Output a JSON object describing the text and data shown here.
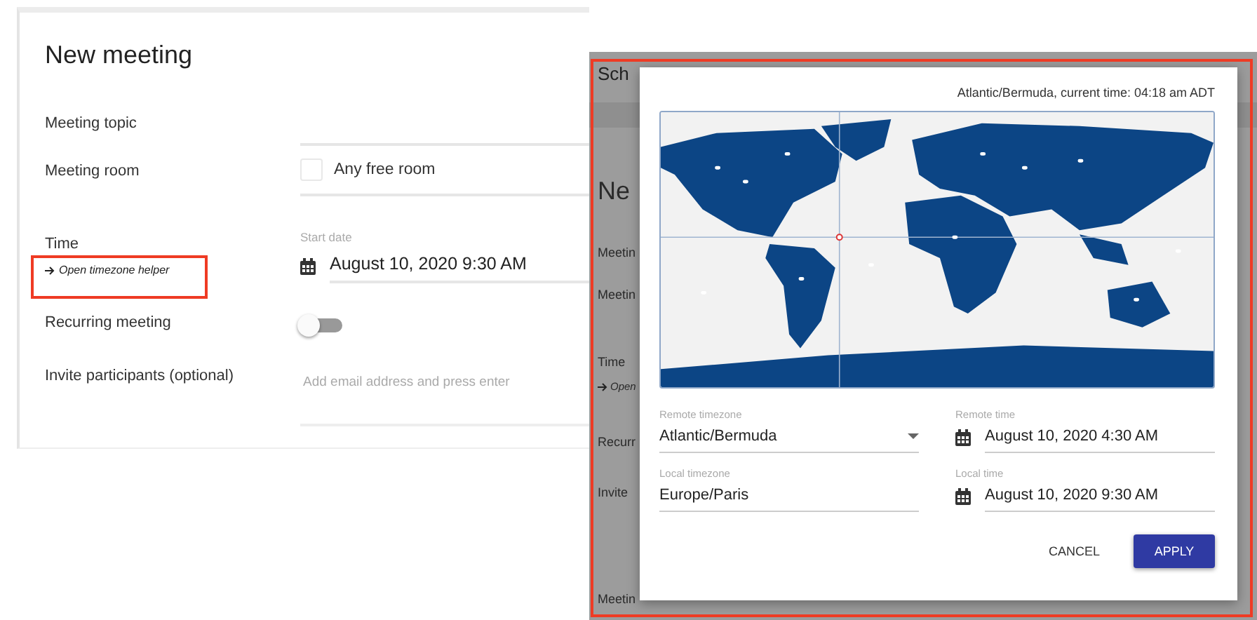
{
  "main_form": {
    "title": "New meeting",
    "fields": [
      {
        "kind": "text",
        "label": "Meeting topic"
      },
      {
        "kind": "checkbox",
        "label": "Meeting room",
        "option": "Any free room",
        "checked": false
      },
      {
        "kind": "date",
        "label": "Time",
        "link": "Open timezone helper",
        "field_label": "Start date",
        "value": "August 10, 2020 9:30 AM"
      },
      {
        "kind": "toggle",
        "label": "Recurring meeting",
        "on": false
      },
      {
        "kind": "email",
        "label": "Invite participants (optional)",
        "placeholder": "Add email address and press enter"
      }
    ]
  },
  "background_screen": {
    "texts": [
      {
        "kind": "title",
        "text": "Sch"
      },
      {
        "kind": "heading",
        "text": "Ne"
      },
      {
        "kind": "label",
        "text": "Meetin"
      },
      {
        "kind": "label",
        "text": "Meetin"
      },
      {
        "kind": "label",
        "text": "Time"
      },
      {
        "kind": "link",
        "text": "Open"
      },
      {
        "kind": "label",
        "text": "Recurr"
      },
      {
        "kind": "label",
        "text": "Invite"
      },
      {
        "kind": "label",
        "text": "Meetin"
      }
    ]
  },
  "timezone_dialog": {
    "current_time": "Atlantic/Bermuda, current time: 04:18 am ADT",
    "fields": [
      {
        "kind": "select",
        "label": "Remote timezone",
        "value": "Atlantic/Bermuda"
      },
      {
        "kind": "date",
        "label": "Remote time",
        "value": "August 10, 2020 4:30 AM"
      },
      {
        "kind": "text",
        "label": "Local timezone",
        "value": "Europe/Paris"
      },
      {
        "kind": "date",
        "label": "Local time",
        "value": "August 10, 2020 9:30 AM"
      }
    ],
    "buttons": [
      {
        "kind": "text",
        "label": "CANCEL"
      },
      {
        "kind": "primary",
        "label": "APPLY"
      }
    ]
  }
}
